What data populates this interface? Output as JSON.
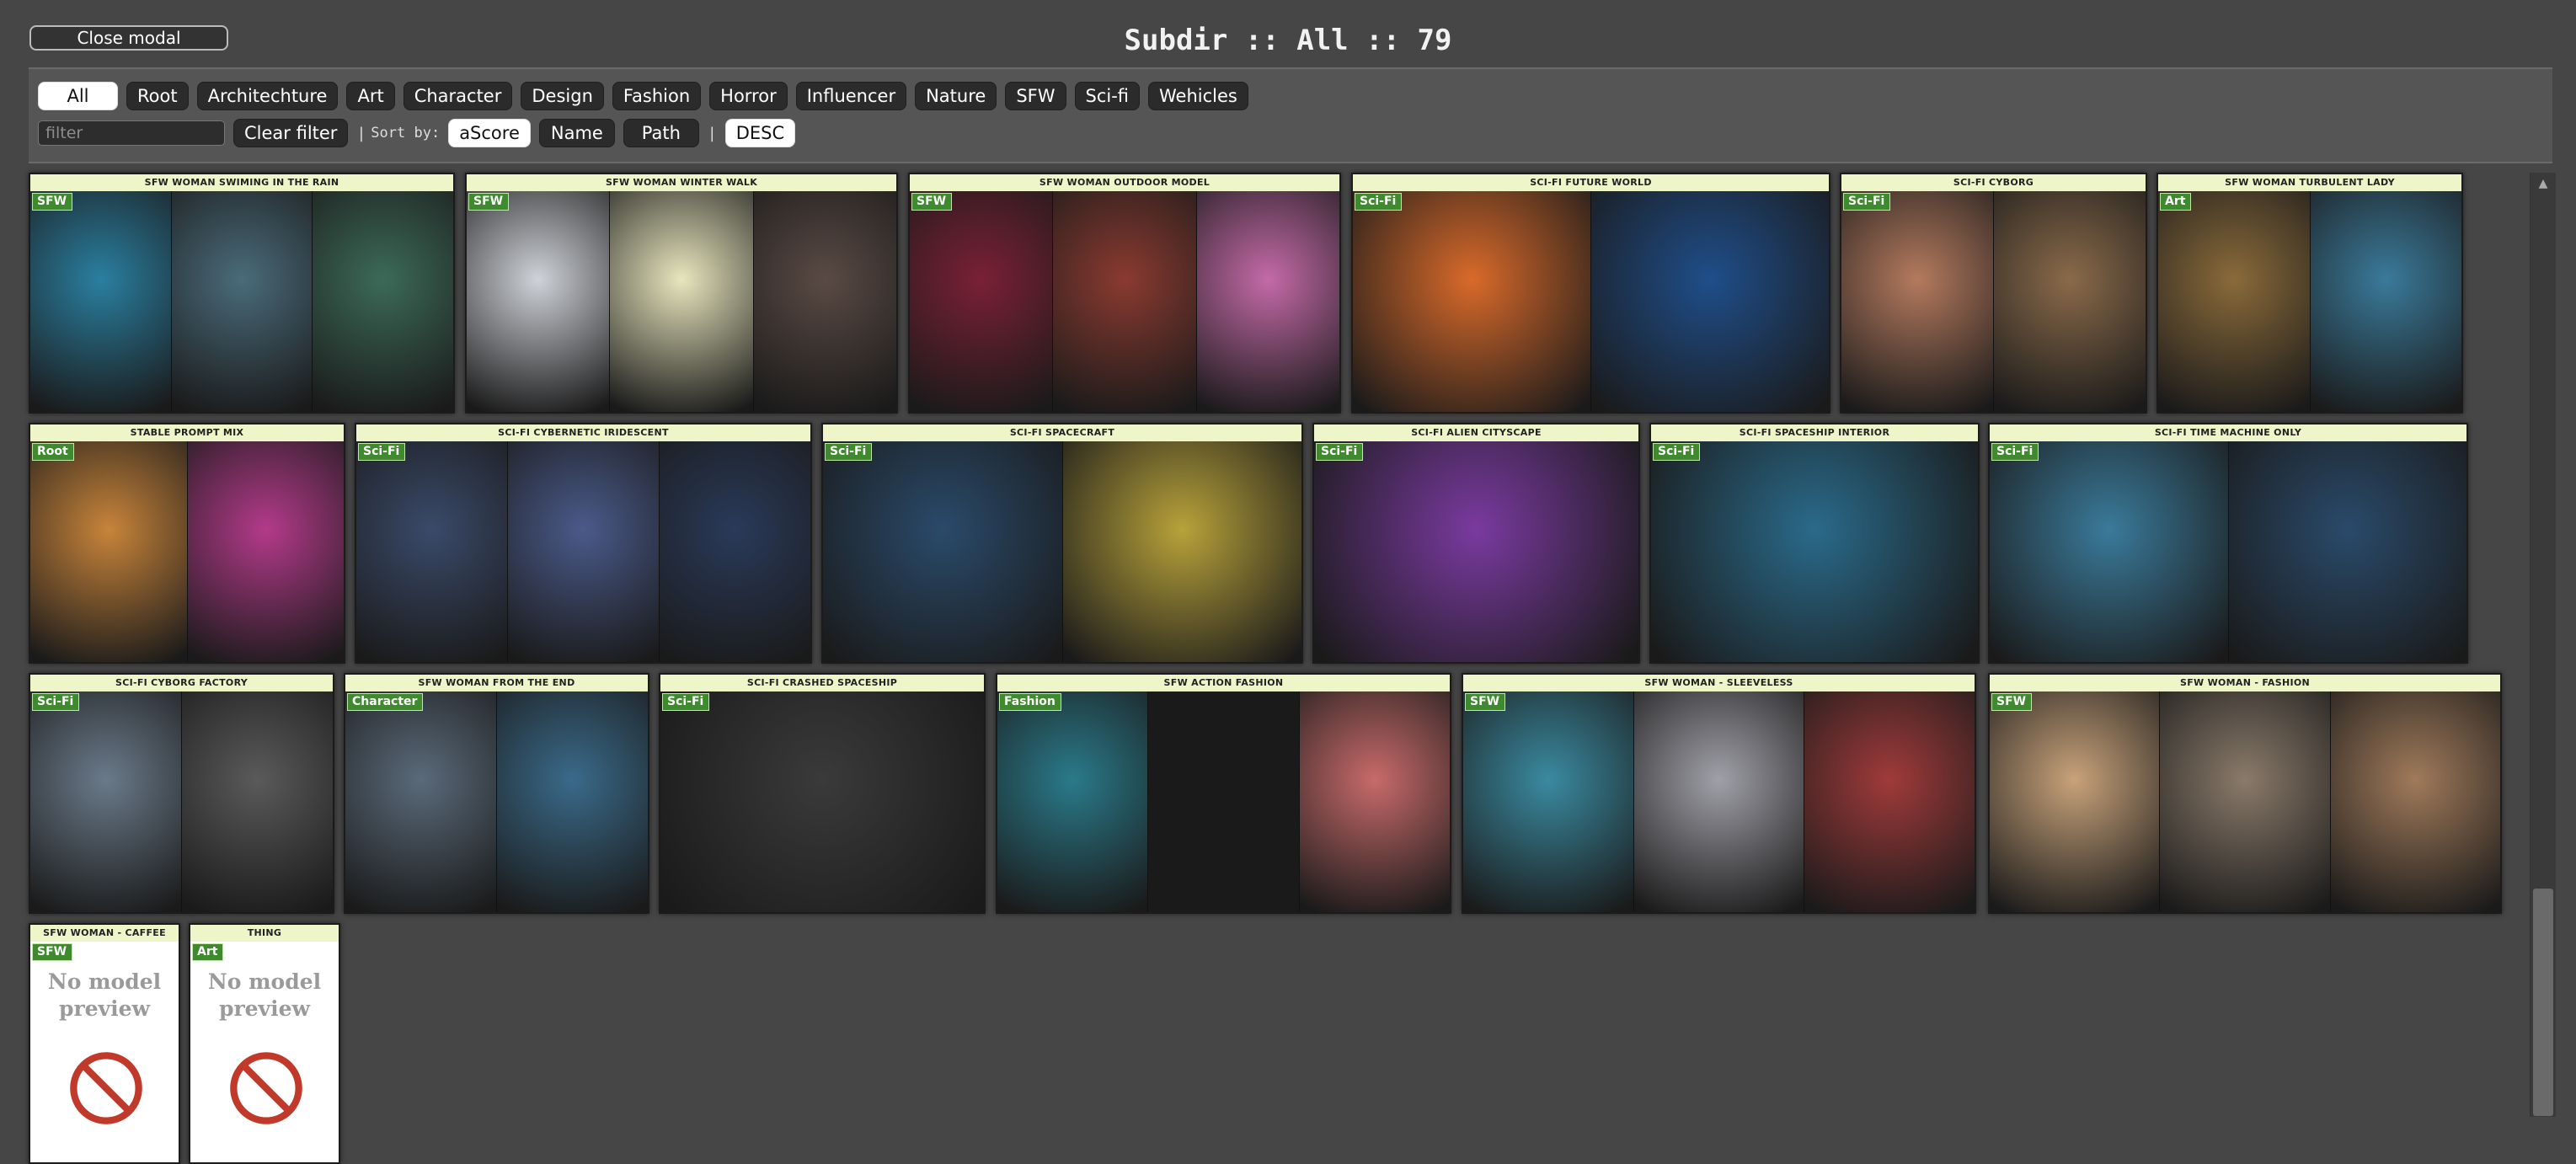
{
  "window": {
    "close_label": "Close modal",
    "title": "Subdir :: All :: 79"
  },
  "filters": {
    "categories": [
      "All",
      "Root",
      "Architechture",
      "Art",
      "Character",
      "Design",
      "Fashion",
      "Horror",
      "Influencer",
      "Nature",
      "SFW",
      "Sci-fi",
      "Wehicles"
    ],
    "active_category": "All",
    "search_placeholder": "filter",
    "search_value": "",
    "clear_label": "Clear filter",
    "separator": "|",
    "sort_label": "Sort by:",
    "sort_options": [
      "aScore",
      "Name",
      "Path"
    ],
    "active_sort": "aScore",
    "order_label": "DESC"
  },
  "no_preview_text": "No model preview",
  "cards": [
    {
      "title": "SFW WOMAN SWIMING IN THE RAIN",
      "tag": "SFW",
      "palette": [
        "#2a7fa0",
        "#4a6b7a",
        "#3c6a58"
      ]
    },
    {
      "title": "SFW WOMAN WINTER WALK",
      "tag": "SFW",
      "palette": [
        "#cfd2d8",
        "#e8e6bd",
        "#5a4a44"
      ]
    },
    {
      "title": "SFW WOMAN OUTDOOR MODEL",
      "tag": "SFW",
      "palette": [
        "#7a2035",
        "#8a3a30",
        "#c46aa8"
      ]
    },
    {
      "title": "SCI-FI FUTURE WORLD",
      "tag": "Sci-Fi",
      "palette": [
        "#d96a2a",
        "#1f4e8a"
      ]
    },
    {
      "title": "SCI-FI CYBORG",
      "tag": "Sci-Fi",
      "palette": [
        "#b47a5e",
        "#8a6a4a"
      ]
    },
    {
      "title": "SFW WOMAN TURBULENT LADY",
      "tag": "Art",
      "palette": [
        "#8a6a3a",
        "#3a7a9a"
      ]
    },
    {
      "title": "STABLE PROMPT MIX",
      "tag": "Root",
      "palette": [
        "#c8843a",
        "#b33a8a"
      ]
    },
    {
      "title": "SCI-FI CYBERNETIC IRIDESCENT",
      "tag": "Sci-Fi",
      "palette": [
        "#3a4a6a",
        "#4a5a8a",
        "#2a3a5a"
      ]
    },
    {
      "title": "SCI-FI SPACECRAFT",
      "tag": "Sci-Fi",
      "palette": [
        "#2a4a6a",
        "#b8a23a"
      ]
    },
    {
      "title": "SCI-FI ALIEN CITYSCAPE",
      "tag": "Sci-Fi",
      "palette": [
        "#7a3aa0"
      ]
    },
    {
      "title": "SCI-FI SPACESHIP INTERIOR",
      "tag": "Sci-Fi",
      "palette": [
        "#2a6a8a"
      ]
    },
    {
      "title": "SCI-FI TIME MACHINE ONLY",
      "tag": "Sci-Fi",
      "palette": [
        "#3a7a9a",
        "#2a4a6a"
      ]
    },
    {
      "title": "SCI-FI CYBORG FACTORY",
      "tag": "Sci-Fi",
      "palette": [
        "#6a7a8a",
        "#5a5a5a"
      ]
    },
    {
      "title": "SFW WOMAN FROM THE END",
      "tag": "Character",
      "palette": [
        "#5a6a7a",
        "#3a6a8a"
      ]
    },
    {
      "title": "SCI-FI CRASHED SPACESHIP",
      "tag": "Sci-Fi",
      "palette": [
        "#3a3a3a"
      ]
    },
    {
      "title": "SFW ACTION FASHION",
      "tag": "Fashion",
      "palette": [
        "#2a7a8a",
        "#1a1a1a",
        "#c86a6a"
      ]
    },
    {
      "title": "SFW WOMAN - SLEEVELESS",
      "tag": "SFW",
      "palette": [
        "#3a8aa0",
        "#a0a0a8",
        "#a03a3a"
      ]
    },
    {
      "title": "SFW WOMAN - FASHION",
      "tag": "SFW",
      "palette": [
        "#c8a27a",
        "#8a7a6a",
        "#a07a5a"
      ]
    },
    {
      "title": "SFW WOMAN - CAFFEE",
      "tag": "SFW",
      "palette": []
    },
    {
      "title": "THING",
      "tag": "Art",
      "palette": []
    }
  ]
}
